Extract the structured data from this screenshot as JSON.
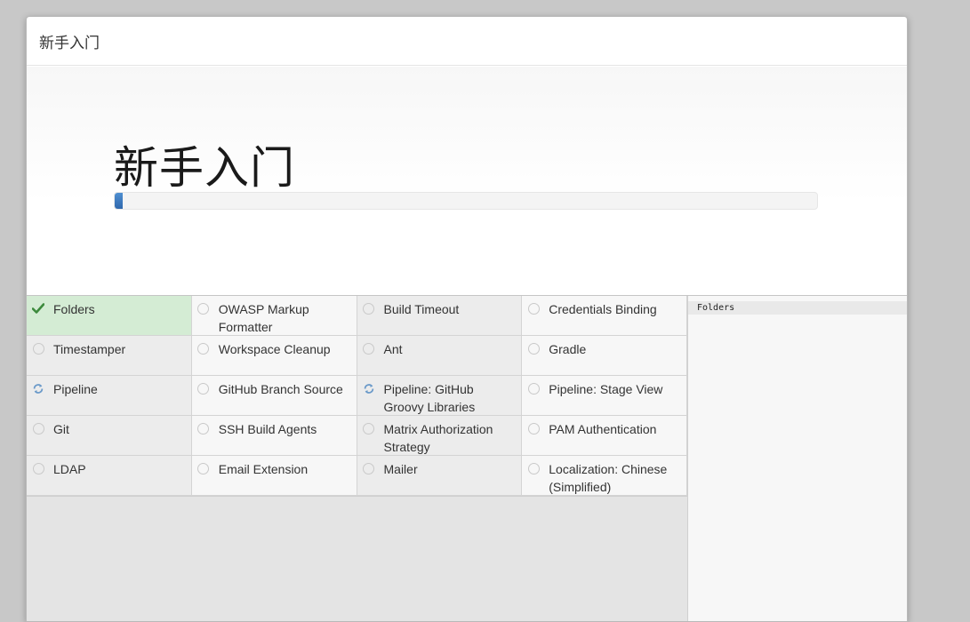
{
  "dialog": {
    "header_title": "新手入门",
    "hero_title": "新手入门",
    "progress": 0.012,
    "accent_color": "#3a78c2"
  },
  "plugins": [
    {
      "name": "Folders",
      "status": "success"
    },
    {
      "name": "OWASP Markup Formatter",
      "status": "pending"
    },
    {
      "name": "Build Timeout",
      "status": "pending"
    },
    {
      "name": "Credentials Binding",
      "status": "pending"
    },
    {
      "name": "Timestamper",
      "status": "pending"
    },
    {
      "name": "Workspace Cleanup",
      "status": "pending"
    },
    {
      "name": "Ant",
      "status": "pending"
    },
    {
      "name": "Gradle",
      "status": "pending"
    },
    {
      "name": "Pipeline",
      "status": "installing"
    },
    {
      "name": "GitHub Branch Source",
      "status": "pending"
    },
    {
      "name": "Pipeline: GitHub Groovy Libraries",
      "status": "installing"
    },
    {
      "name": "Pipeline: Stage View",
      "status": "pending"
    },
    {
      "name": "Git",
      "status": "pending"
    },
    {
      "name": "SSH Build Agents",
      "status": "pending"
    },
    {
      "name": "Matrix Authorization Strategy",
      "status": "pending"
    },
    {
      "name": "PAM Authentication",
      "status": "pending"
    },
    {
      "name": "LDAP",
      "status": "pending"
    },
    {
      "name": "Email Extension",
      "status": "pending"
    },
    {
      "name": "Mailer",
      "status": "pending"
    },
    {
      "name": "Localization: Chinese (Simplified)",
      "status": "pending"
    }
  ],
  "log": {
    "lines": [
      "Folders"
    ]
  },
  "icons": {
    "success": "check-icon",
    "installing": "refresh-icon",
    "pending": "circle-icon"
  },
  "colors": {
    "success_bg": "#d4ecd4",
    "success_icon": "#3c8a3c",
    "installing_icon": "#6b9ac9"
  }
}
